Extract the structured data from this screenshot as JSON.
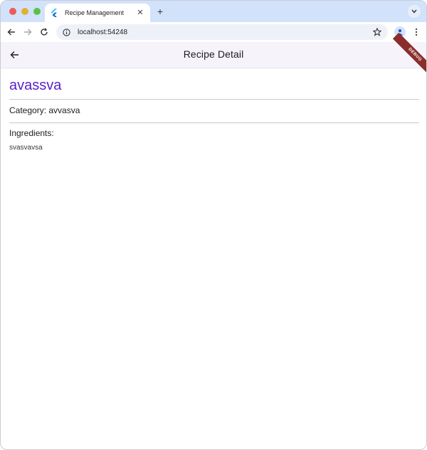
{
  "browser": {
    "tab_title": "Recipe Management",
    "url": "localhost:54248",
    "icons": {
      "favicon": "flutter-icon",
      "close": "close-icon",
      "new_tab": "plus-icon",
      "tab_menu": "chevron-down-icon",
      "back": "arrow-left-icon",
      "forward": "arrow-right-icon",
      "reload": "reload-icon",
      "site_info": "info-icon",
      "bookmark": "star-icon",
      "profile": "person-icon",
      "menu": "kebab-icon"
    }
  },
  "app_bar": {
    "title": "Recipe Detail",
    "debug_label": "DEBUG"
  },
  "recipe": {
    "name": "avassva",
    "category_line": "Category: avvasva",
    "ingredients_heading": "Ingredients:",
    "ingredients_text": "svasvavsa"
  },
  "colors": {
    "accent": "#5a22c8",
    "app_bar_bg": "#f6f3fa",
    "tab_strip_bg": "#d3e2fb",
    "debug_banner": "#8b2e2b"
  }
}
